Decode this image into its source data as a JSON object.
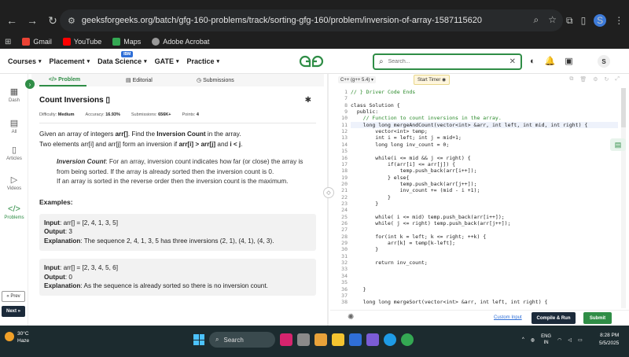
{
  "browser": {
    "url": "geeksforgeeks.org/batch/gfg-160-problems/track/sorting-gfg-160/problem/inversion-of-array-1587115620",
    "profile_initial": "S",
    "bookmarks": [
      "Gmail",
      "YouTube",
      "Maps",
      "Adobe Acrobat"
    ]
  },
  "header": {
    "menu": [
      "Courses",
      "Placement",
      "Data Science",
      "GATE",
      "Practice"
    ],
    "badge": "IBM",
    "search_placeholder": "Search...",
    "avatar_initial": "S"
  },
  "rail": {
    "items": [
      "Dash",
      "All",
      "Articles",
      "Videos",
      "Problems"
    ],
    "prev": "« Prev",
    "next": "Next »"
  },
  "tabs": {
    "problem": "Problem",
    "editorial": "Editorial",
    "submissions": "Submissions"
  },
  "problem": {
    "title": "Count Inversions",
    "difficulty_label": "Difficulty:",
    "difficulty": "Medium",
    "accuracy_label": "Accuracy:",
    "accuracy": "16.93%",
    "submissions_label": "Submissions:",
    "submissions": "656K+",
    "points_label": "Points:",
    "points": "4",
    "desc_1a": "Given an array of integers ",
    "desc_1b": "arr[]",
    "desc_1c": ". Find the ",
    "desc_1d": "Inversion Count",
    "desc_1e": " in the array.",
    "desc_2a": "Two elements arr[i] and arr[j] form an inversion if ",
    "desc_2b": "arr[i] > arr[j]",
    "desc_2c": " and ",
    "desc_2d": "i < j",
    "desc_2e": ".",
    "note_label": "Inversion Count",
    "note_1": ": For an array, inversion count indicates how far (or close) the array is from being sorted. If the array is already sorted then the inversion count is 0.",
    "note_2": "If an array is sorted in the reverse order then the inversion count is the maximum.",
    "examples_heading": "Examples:",
    "examples": [
      {
        "input_label": "Input",
        "input": ": arr[] = [2, 4, 1, 3, 5]",
        "output_label": "Output",
        "output": ": 3",
        "explanation_label": "Explanation",
        "explanation": ": The sequence 2, 4, 1, 3, 5 has three inversions (2, 1), (4, 1), (4, 3)."
      },
      {
        "input_label": "Input",
        "input": ": arr[] = [2, 3, 4, 5, 6]",
        "output_label": "Output",
        "output": ": 0",
        "explanation_label": "Explanation",
        "explanation": ": As the sequence is already sorted so there is no inversion count."
      }
    ]
  },
  "editor": {
    "language": "C++ (g++ 5.4)",
    "timer": "Start Timer",
    "custom_input": "Custom Input",
    "compile": "Compile & Run",
    "submit": "Submit",
    "lines": [
      {
        "n": "1",
        "t": "// } Driver Code Ends"
      },
      {
        "n": "7",
        "t": ""
      },
      {
        "n": "8",
        "t": "class Solution {"
      },
      {
        "n": "9",
        "t": "  public:"
      },
      {
        "n": "10",
        "t": "    // Function to count inversions in the array."
      },
      {
        "n": "11",
        "t": "    long long mergeAndCount(vector<int> &arr, int left, int mid, int right) {"
      },
      {
        "n": "12",
        "t": "        vector<int> temp;"
      },
      {
        "n": "13",
        "t": "        int i = left; int j = mid+1;"
      },
      {
        "n": "14",
        "t": "        long long inv_count = 0;"
      },
      {
        "n": "15",
        "t": ""
      },
      {
        "n": "16",
        "t": "        while(i <= mid && j <= right) {"
      },
      {
        "n": "17",
        "t": "            if(arr[i] <= arr[j]) {"
      },
      {
        "n": "18",
        "t": "                temp.push_back(arr[i++]);"
      },
      {
        "n": "19",
        "t": "            } else{"
      },
      {
        "n": "20",
        "t": "                temp.push_back(arr[j++]);"
      },
      {
        "n": "21",
        "t": "                inv_count += (mid - i +1);"
      },
      {
        "n": "22",
        "t": "            }"
      },
      {
        "n": "23",
        "t": "        }"
      },
      {
        "n": "24",
        "t": ""
      },
      {
        "n": "25",
        "t": "        while( i <= mid) temp.push_back(arr[i++]);"
      },
      {
        "n": "26",
        "t": "        while( j <= right) temp.push_back(arr[j++]);"
      },
      {
        "n": "27",
        "t": ""
      },
      {
        "n": "28",
        "t": "        for(int k = left; k <= right; ++k) {"
      },
      {
        "n": "29",
        "t": "            arr[k] = temp[k-left];"
      },
      {
        "n": "30",
        "t": "        }"
      },
      {
        "n": "31",
        "t": ""
      },
      {
        "n": "32",
        "t": "        return inv_count;"
      },
      {
        "n": "33",
        "t": ""
      },
      {
        "n": "34",
        "t": ""
      },
      {
        "n": "35",
        "t": ""
      },
      {
        "n": "36",
        "t": "    }"
      },
      {
        "n": "37",
        "t": ""
      },
      {
        "n": "38",
        "t": "    long long mergeSort(vector<int> &arr, int left, int right) {"
      }
    ]
  },
  "taskbar": {
    "temp": "30°C",
    "weather": "Haze",
    "search": "Search",
    "lang_1": "ENG",
    "lang_2": "IN",
    "time": "8:28 PM",
    "date": "5/5/2025"
  }
}
